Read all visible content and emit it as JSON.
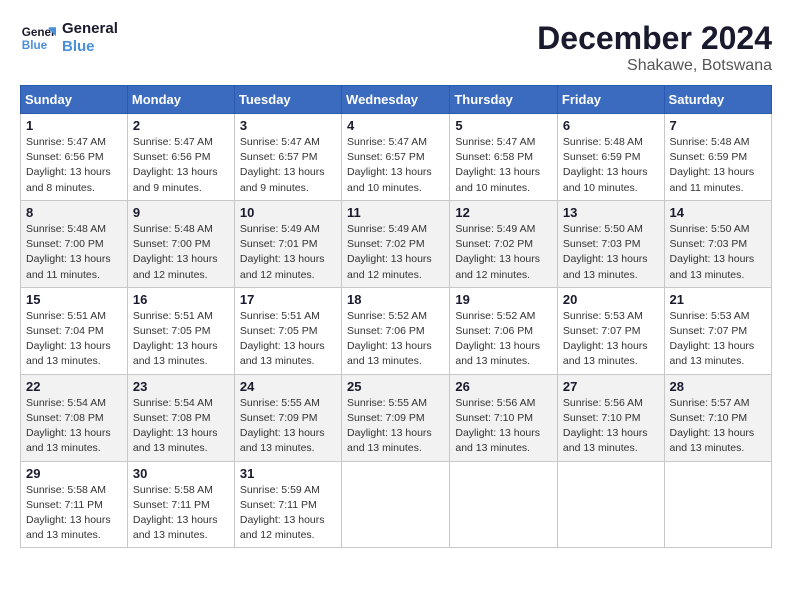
{
  "logo": {
    "line1": "General",
    "line2": "Blue"
  },
  "title": "December 2024",
  "location": "Shakawe, Botswana",
  "days_of_week": [
    "Sunday",
    "Monday",
    "Tuesday",
    "Wednesday",
    "Thursday",
    "Friday",
    "Saturday"
  ],
  "weeks": [
    [
      {
        "day": "1",
        "sunrise": "5:47 AM",
        "sunset": "6:56 PM",
        "daylight": "13 hours and 8 minutes."
      },
      {
        "day": "2",
        "sunrise": "5:47 AM",
        "sunset": "6:56 PM",
        "daylight": "13 hours and 9 minutes."
      },
      {
        "day": "3",
        "sunrise": "5:47 AM",
        "sunset": "6:57 PM",
        "daylight": "13 hours and 9 minutes."
      },
      {
        "day": "4",
        "sunrise": "5:47 AM",
        "sunset": "6:57 PM",
        "daylight": "13 hours and 10 minutes."
      },
      {
        "day": "5",
        "sunrise": "5:47 AM",
        "sunset": "6:58 PM",
        "daylight": "13 hours and 10 minutes."
      },
      {
        "day": "6",
        "sunrise": "5:48 AM",
        "sunset": "6:59 PM",
        "daylight": "13 hours and 10 minutes."
      },
      {
        "day": "7",
        "sunrise": "5:48 AM",
        "sunset": "6:59 PM",
        "daylight": "13 hours and 11 minutes."
      }
    ],
    [
      {
        "day": "8",
        "sunrise": "5:48 AM",
        "sunset": "7:00 PM",
        "daylight": "13 hours and 11 minutes."
      },
      {
        "day": "9",
        "sunrise": "5:48 AM",
        "sunset": "7:00 PM",
        "daylight": "13 hours and 12 minutes."
      },
      {
        "day": "10",
        "sunrise": "5:49 AM",
        "sunset": "7:01 PM",
        "daylight": "13 hours and 12 minutes."
      },
      {
        "day": "11",
        "sunrise": "5:49 AM",
        "sunset": "7:02 PM",
        "daylight": "13 hours and 12 minutes."
      },
      {
        "day": "12",
        "sunrise": "5:49 AM",
        "sunset": "7:02 PM",
        "daylight": "13 hours and 12 minutes."
      },
      {
        "day": "13",
        "sunrise": "5:50 AM",
        "sunset": "7:03 PM",
        "daylight": "13 hours and 13 minutes."
      },
      {
        "day": "14",
        "sunrise": "5:50 AM",
        "sunset": "7:03 PM",
        "daylight": "13 hours and 13 minutes."
      }
    ],
    [
      {
        "day": "15",
        "sunrise": "5:51 AM",
        "sunset": "7:04 PM",
        "daylight": "13 hours and 13 minutes."
      },
      {
        "day": "16",
        "sunrise": "5:51 AM",
        "sunset": "7:05 PM",
        "daylight": "13 hours and 13 minutes."
      },
      {
        "day": "17",
        "sunrise": "5:51 AM",
        "sunset": "7:05 PM",
        "daylight": "13 hours and 13 minutes."
      },
      {
        "day": "18",
        "sunrise": "5:52 AM",
        "sunset": "7:06 PM",
        "daylight": "13 hours and 13 minutes."
      },
      {
        "day": "19",
        "sunrise": "5:52 AM",
        "sunset": "7:06 PM",
        "daylight": "13 hours and 13 minutes."
      },
      {
        "day": "20",
        "sunrise": "5:53 AM",
        "sunset": "7:07 PM",
        "daylight": "13 hours and 13 minutes."
      },
      {
        "day": "21",
        "sunrise": "5:53 AM",
        "sunset": "7:07 PM",
        "daylight": "13 hours and 13 minutes."
      }
    ],
    [
      {
        "day": "22",
        "sunrise": "5:54 AM",
        "sunset": "7:08 PM",
        "daylight": "13 hours and 13 minutes."
      },
      {
        "day": "23",
        "sunrise": "5:54 AM",
        "sunset": "7:08 PM",
        "daylight": "13 hours and 13 minutes."
      },
      {
        "day": "24",
        "sunrise": "5:55 AM",
        "sunset": "7:09 PM",
        "daylight": "13 hours and 13 minutes."
      },
      {
        "day": "25",
        "sunrise": "5:55 AM",
        "sunset": "7:09 PM",
        "daylight": "13 hours and 13 minutes."
      },
      {
        "day": "26",
        "sunrise": "5:56 AM",
        "sunset": "7:10 PM",
        "daylight": "13 hours and 13 minutes."
      },
      {
        "day": "27",
        "sunrise": "5:56 AM",
        "sunset": "7:10 PM",
        "daylight": "13 hours and 13 minutes."
      },
      {
        "day": "28",
        "sunrise": "5:57 AM",
        "sunset": "7:10 PM",
        "daylight": "13 hours and 13 minutes."
      }
    ],
    [
      {
        "day": "29",
        "sunrise": "5:58 AM",
        "sunset": "7:11 PM",
        "daylight": "13 hours and 13 minutes."
      },
      {
        "day": "30",
        "sunrise": "5:58 AM",
        "sunset": "7:11 PM",
        "daylight": "13 hours and 13 minutes."
      },
      {
        "day": "31",
        "sunrise": "5:59 AM",
        "sunset": "7:11 PM",
        "daylight": "13 hours and 12 minutes."
      },
      null,
      null,
      null,
      null
    ]
  ],
  "labels": {
    "sunrise": "Sunrise:",
    "sunset": "Sunset:",
    "daylight": "Daylight:"
  }
}
